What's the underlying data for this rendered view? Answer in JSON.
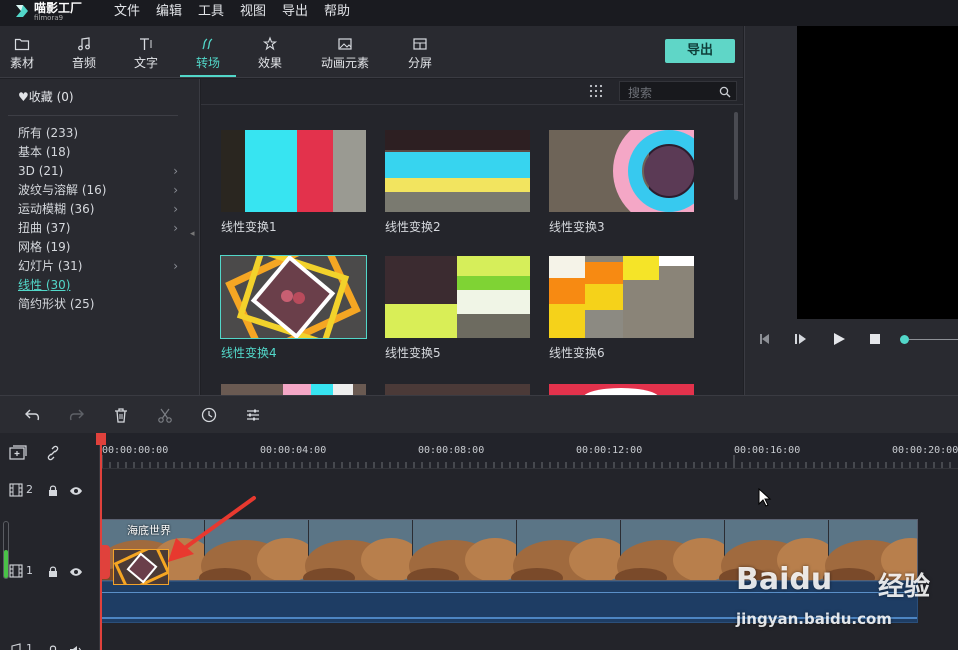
{
  "app": {
    "name": "喵影工厂",
    "subtitle": "filmora9"
  },
  "menu": [
    "文件",
    "编辑",
    "工具",
    "视图",
    "导出",
    "帮助"
  ],
  "tabs": [
    {
      "label": "素材",
      "icon": "folder-icon"
    },
    {
      "label": "音频",
      "icon": "music-note-icon"
    },
    {
      "label": "文字",
      "icon": "text-icon"
    },
    {
      "label": "转场",
      "icon": "transition-icon",
      "active": true
    },
    {
      "label": "效果",
      "icon": "effects-icon"
    },
    {
      "label": "动画元素",
      "icon": "image-icon"
    },
    {
      "label": "分屏",
      "icon": "split-screen-icon"
    }
  ],
  "export_label": "导出",
  "sidebar": {
    "favorites": "收藏 (0)",
    "categories": [
      {
        "label": "所有 (233)",
        "expandable": false
      },
      {
        "label": "基本 (18)",
        "expandable": false
      },
      {
        "label": "3D (21)",
        "expandable": true
      },
      {
        "label": "波纹与溶解 (16)",
        "expandable": true
      },
      {
        "label": "运动模糊 (36)",
        "expandable": true
      },
      {
        "label": "扭曲 (37)",
        "expandable": true
      },
      {
        "label": "网格 (19)",
        "expandable": false
      },
      {
        "label": "幻灯片 (31)",
        "expandable": true
      },
      {
        "label": "线性 (30)",
        "expandable": false,
        "active": true
      },
      {
        "label": "简约形状 (25)",
        "expandable": false
      }
    ]
  },
  "search": {
    "placeholder": "搜索"
  },
  "thumbnails": [
    {
      "label": "线性变换1"
    },
    {
      "label": "线性变换2"
    },
    {
      "label": "线性变换3"
    },
    {
      "label": "线性变换4",
      "selected": true
    },
    {
      "label": "线性变换5"
    },
    {
      "label": "线性变换6"
    }
  ],
  "timeline": {
    "ruler": [
      "00:00:00:00",
      "00:00:04:00",
      "00:00:08:00",
      "00:00:12:00",
      "00:00:16:00",
      "00:00:20:00"
    ],
    "tracks": [
      {
        "label": "2"
      },
      {
        "label": "1"
      },
      {
        "label": "1"
      }
    ],
    "clip_title": "海底世界"
  },
  "watermark": {
    "brand": "Baidu",
    "cn": "经验",
    "url": "jingyan.baidu.com"
  },
  "colors": {
    "accent": "#52d7c9",
    "playhead": "#e0413c",
    "arrow": "#e8392f"
  }
}
